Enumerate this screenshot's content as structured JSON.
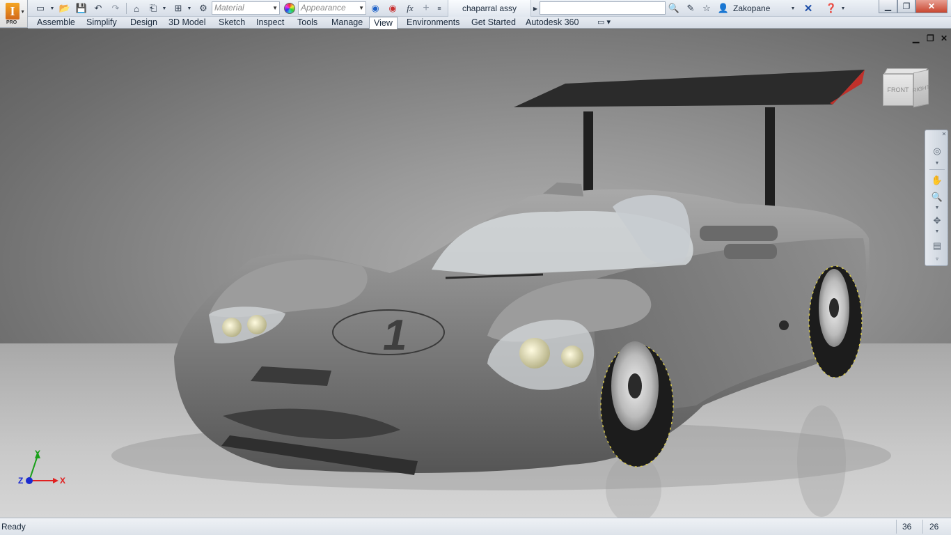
{
  "app": {
    "badge": "PRO",
    "logo_letter": "I"
  },
  "quick_access": {
    "material_placeholder": "Material",
    "appearance_placeholder": "Appearance",
    "fx_label": "fx"
  },
  "document_title": "chaparral assy",
  "search": {
    "value": "",
    "placeholder": ""
  },
  "user": {
    "name": "Zakopane"
  },
  "menu_tabs": [
    {
      "label": "Assemble"
    },
    {
      "label": "Simplify"
    },
    {
      "label": "Design"
    },
    {
      "label": "3D Model"
    },
    {
      "label": "Sketch"
    },
    {
      "label": "Inspect"
    },
    {
      "label": "Tools"
    },
    {
      "label": "Manage"
    },
    {
      "label": "View",
      "active": true
    },
    {
      "label": "Environments"
    },
    {
      "label": "Get Started"
    },
    {
      "label": "Autodesk 360"
    }
  ],
  "viewcube": {
    "front_label": "FRONT",
    "right_label": "RIGHT"
  },
  "model": {
    "race_number": "1",
    "colors": {
      "body": "#8a8a8a",
      "wing": "#2a2a2a",
      "wing_tip": "#c0302a",
      "glass": "#d8dde0",
      "lamp": "#e9e5b8",
      "tire": "#1c1c1c",
      "tire_lettering": "#d8c84a"
    }
  },
  "triad": {
    "x": "X",
    "y": "Y",
    "z": "Z",
    "x_color": "#e02020",
    "y_color": "#1aa01a",
    "z_color": "#1a2ad0"
  },
  "status": {
    "text": "Ready",
    "count1": "36",
    "count2": "26"
  }
}
